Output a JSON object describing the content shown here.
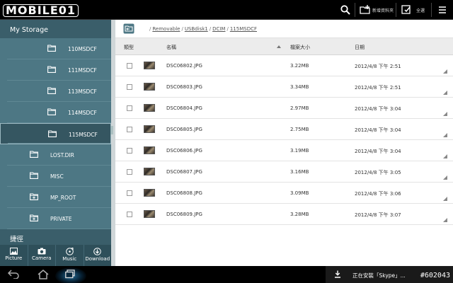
{
  "app": {
    "logo_text": "MOBILE01",
    "new_folder_label": "新增資料夾",
    "select_all_label": "全選"
  },
  "sidebar": {
    "header": "My Storage",
    "items": [
      {
        "label": "110MSDCF",
        "indent": 2,
        "icon": "folder-icon",
        "selected": false
      },
      {
        "label": "111MSDCF",
        "indent": 2,
        "icon": "folder-icon",
        "selected": false
      },
      {
        "label": "113MSDCF",
        "indent": 2,
        "icon": "folder-icon",
        "selected": false
      },
      {
        "label": "114MSDCF",
        "indent": 2,
        "icon": "folder-icon",
        "selected": false
      },
      {
        "label": "115MSDCF",
        "indent": 2,
        "icon": "folder-icon",
        "selected": true
      },
      {
        "label": "LOST.DIR",
        "indent": 1,
        "icon": "folder-icon",
        "selected": false
      },
      {
        "label": "MISC",
        "indent": 1,
        "icon": "folder-icon",
        "selected": false
      },
      {
        "label": "MP_ROOT",
        "indent": 1,
        "icon": "folder-plus-icon",
        "selected": false
      },
      {
        "label": "PRIVATE",
        "indent": 1,
        "icon": "folder-plus-icon",
        "selected": false
      }
    ],
    "shortcuts_header": "捷徑",
    "tabs": [
      {
        "label": "Picture",
        "icon": "picture-icon"
      },
      {
        "label": "Camera",
        "icon": "camera-icon"
      },
      {
        "label": "Music",
        "icon": "music-icon"
      },
      {
        "label": "Download",
        "icon": "download-icon"
      }
    ]
  },
  "path": {
    "segments": [
      "Removable",
      "USBdisk1",
      "DCIM",
      "115MSDCF"
    ],
    "separator": "/"
  },
  "table": {
    "columns": {
      "type": "類型",
      "name": "名稱",
      "size": "檔案大小",
      "date": "日期"
    },
    "rows": [
      {
        "name": "DSC06802.JPG",
        "size": "3.22MB",
        "date": "2012/4/8 下午 2:51"
      },
      {
        "name": "DSC06803.JPG",
        "size": "3.34MB",
        "date": "2012/4/8 下午 2:51"
      },
      {
        "name": "DSC06804.JPG",
        "size": "2.97MB",
        "date": "2012/4/8 下午 3:04"
      },
      {
        "name": "DSC06805.JPG",
        "size": "2.75MB",
        "date": "2012/4/8 下午 3:04"
      },
      {
        "name": "DSC06806.JPG",
        "size": "3.19MB",
        "date": "2012/4/8 下午 3:04"
      },
      {
        "name": "DSC06807.JPG",
        "size": "3.16MB",
        "date": "2012/4/8 下午 3:05"
      },
      {
        "name": "DSC06808.JPG",
        "size": "3.09MB",
        "date": "2012/4/8 下午 3:06"
      },
      {
        "name": "DSC06809.JPG",
        "size": "3.28MB",
        "date": "2012/4/8 下午 3:07"
      }
    ]
  },
  "status": {
    "notification": "正在安裝「Skype」...",
    "watermark": "#602043"
  },
  "colors": {
    "sidebar": "#4d7784",
    "sidebar_dark": "#3a5e6a",
    "header_bg": "#ececec"
  }
}
